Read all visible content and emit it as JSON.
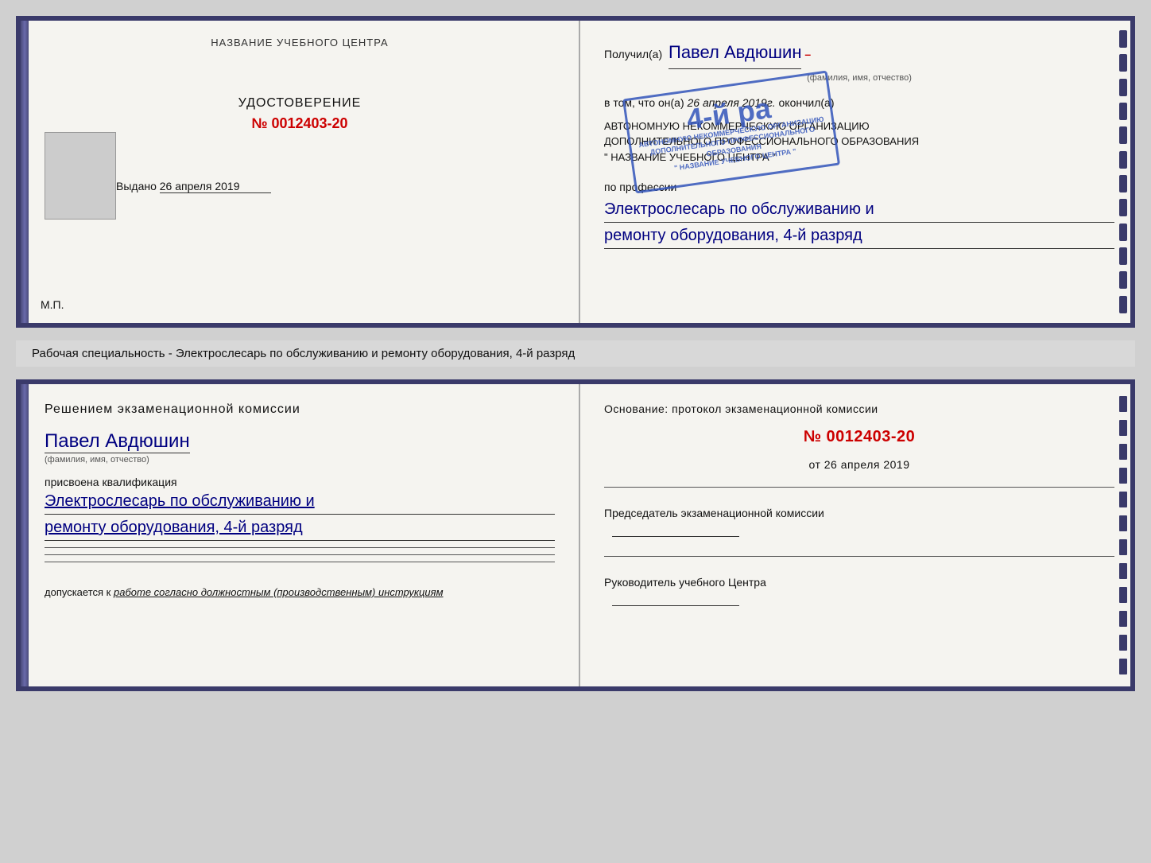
{
  "topDoc": {
    "left": {
      "header": "НАЗВАНИЕ УЧЕБНОГО ЦЕНТРА",
      "certTitle": "УДОСТОВЕРЕНИЕ",
      "certNumber": "№ 0012403-20",
      "issuedLabel": "Выдано",
      "issuedDate": "26 апреля 2019",
      "mpLabel": "М.П."
    },
    "right": {
      "receivedLabel": "Получил(а)",
      "receivedName": "Павел Авдюшин",
      "fioLabel": "(фамилия, имя, отчество)",
      "vtomLabel": "в том, что он(а)",
      "vtomDate": "26 апреля 2019г.",
      "okonchilLabel": "окончил(а)",
      "orgLine1": "АВТОНОМНУЮ НЕКОММЕРЧЕСКУЮ ОРГАНИЗАЦИЮ",
      "orgLine2": "ДОПОЛНИТЕЛЬНОГО ПРОФЕССИОНАЛЬНОГО ОБРАЗОВАНИЯ",
      "orgLine3": "\" НАЗВАНИЕ УЧЕБНОГО ЦЕНТРА \"",
      "professionLabel": "по профессии",
      "profession1": "Электрослесарь по обслуживанию и",
      "profession2": "ремонту оборудования, 4-й разряд",
      "stampLine1": "4-й ра",
      "stampSmall1": "АВТОНОМНУЮ НЕКОММЕРЧЕСКУЮ ОРГАНИЗАЦИЮ",
      "stampSmall2": "ДОПОЛНИТЕЛЬНОГО ПРОФЕССИОНАЛЬНОГО ОБРАЗОВАНИЯ",
      "stampSmall3": "\" НАЗВАНИЕ УЧЕБНОГО ЦЕНТРА \""
    }
  },
  "middleLabel": "Рабочая специальность - Электрослесарь по обслуживанию и ремонту оборудования, 4-й разряд",
  "bottomDoc": {
    "left": {
      "commissionTitle": "Решением экзаменационной комиссии",
      "personName": "Павел Авдюшин",
      "fioLabel": "(фамилия, имя, отчество)",
      "prisvoenaLabel": "присвоена квалификация",
      "qual1": "Электрослесарь по обслуживанию и",
      "qual2": "ремонту оборудования, 4-й разряд",
      "dopuskLabel": "допускается к",
      "dopuskItalic": "работе согласно должностным (производственным) инструкциям"
    },
    "right": {
      "osnovLabel": "Основание: протокол экзаменационной комиссии",
      "protocolNumber": "№ 0012403-20",
      "fromLabel": "от",
      "fromDate": "26 апреля 2019",
      "chairmanLabel": "Председатель экзаменационной комиссии",
      "directorLabel": "Руководитель учебного Центра"
    }
  },
  "decorBars": [
    1,
    2,
    3,
    4,
    5,
    6,
    7,
    8,
    9,
    10,
    11,
    12,
    13,
    14,
    15
  ]
}
